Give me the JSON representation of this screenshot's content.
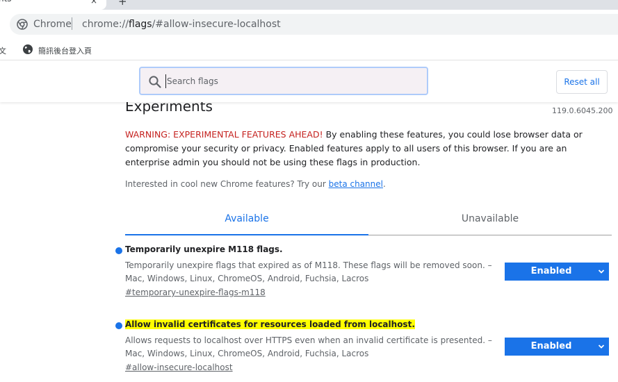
{
  "browser": {
    "tab_title": "nts",
    "tab_close": "×",
    "new_tab": "+",
    "omnibox": {
      "site_label": "Chrome",
      "url_prefix": "chrome://",
      "url_host": "flags",
      "url_rest": "/#allow-insecure-localhost"
    },
    "bookmarks": {
      "left_fragment": "文",
      "item_label": "簡訊後台登入頁"
    }
  },
  "header": {
    "search": {
      "placeholder": "Search flags",
      "value": ""
    },
    "reset_label": "Reset all"
  },
  "page": {
    "title": "Experiments",
    "version": "119.0.6045.200",
    "warning_red": "WARNING: EXPERIMENTAL FEATURES AHEAD!",
    "warning_text": " By enabling these features, you could lose browser data or compromise your security or privacy. Enabled features apply to all users of this browser. If you are an enterprise admin you should not be using these flags in production.",
    "interested_text": "Interested in cool new Chrome features? Try our ",
    "beta_link": "beta channel",
    "interested_end": ".",
    "tabs": [
      {
        "label": "Available",
        "active": true
      },
      {
        "label": "Unavailable",
        "active": false
      }
    ],
    "flags": [
      {
        "name": "Temporarily unexpire M118 flags.",
        "description": "Temporarily unexpire flags that expired as of M118. These flags will be removed soon. – Mac, Windows, Linux, ChromeOS, Android, Fuchsia, Lacros",
        "link": "#temporary-unexpire-flags-m118",
        "state": "Enabled",
        "highlighted": false
      },
      {
        "name": "Allow invalid certificates for resources loaded from localhost.",
        "description": "Allows requests to localhost over HTTPS even when an invalid certificate is presented. – Mac, Windows, Linux, ChromeOS, Android, Fuchsia, Lacros",
        "link": "#allow-insecure-localhost",
        "state": "Enabled",
        "highlighted": true
      }
    ]
  },
  "colors": {
    "accent": "#1a73e8",
    "warning": "#c5221f",
    "highlight": "#ffff00"
  },
  "icons": [
    "chrome-site-icon",
    "globe-icon",
    "search-icon",
    "chevron-down-icon"
  ]
}
